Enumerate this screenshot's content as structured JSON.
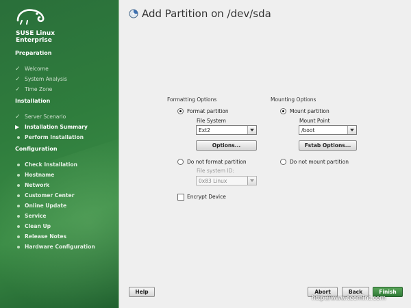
{
  "sidebar": {
    "brand_line1": "SUSE Linux",
    "brand_line2": "Enterprise",
    "sections": {
      "preparation": "Preparation",
      "installation": "Installation",
      "configuration": "Configuration"
    },
    "preparation_items": [
      "Welcome",
      "System Analysis",
      "Time Zone"
    ],
    "installation_items": [
      "Server Scenario",
      "Installation Summary",
      "Perform Installation"
    ],
    "configuration_items": [
      "Check Installation",
      "Hostname",
      "Network",
      "Customer Center",
      "Online Update",
      "Service",
      "Clean Up",
      "Release Notes",
      "Hardware Configuration"
    ]
  },
  "main": {
    "title": "Add Partition on /dev/sda",
    "formatting": {
      "group_label": "Formatting Options",
      "format_partition": "Format partition",
      "file_system_label": "File System",
      "file_system_value": "Ext2",
      "options_button": "Options...",
      "do_not_format": "Do not format partition",
      "fs_id_label": "File system ID:",
      "fs_id_value": "0x83 Linux",
      "encrypt_device": "Encrypt Device"
    },
    "mounting": {
      "group_label": "Mounting Options",
      "mount_partition": "Mount partition",
      "mount_point_label": "Mount Point",
      "mount_point_value": "/boot",
      "fstab_button": "Fstab Options...",
      "do_not_mount": "Do not mount partition"
    }
  },
  "footer": {
    "help": "Help",
    "abort": "Abort",
    "back": "Back",
    "finish": "Finish"
  },
  "watermark": "http://www.tecmint.com",
  "colors": {
    "sidebar_green": "#2f7d3d",
    "finish_green": "#3a8a40",
    "background": "#efefef"
  }
}
